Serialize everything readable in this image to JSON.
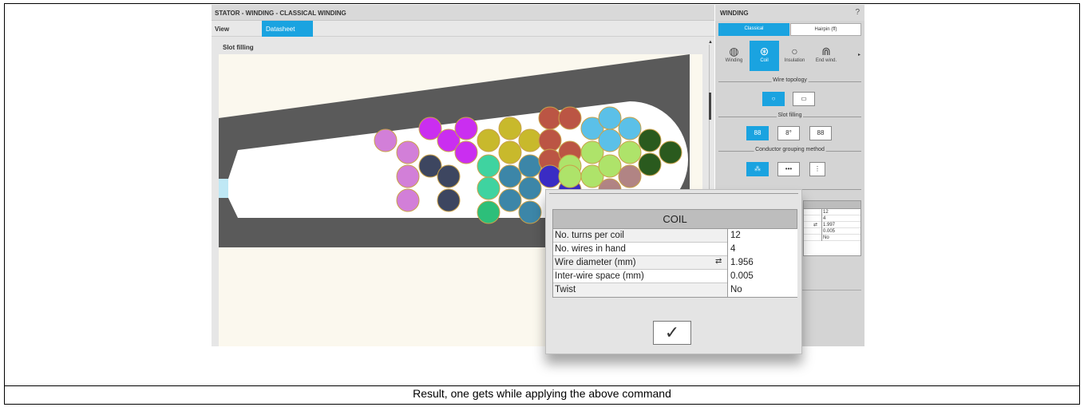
{
  "main": {
    "title": "STATOR - WINDING - CLASSICAL WINDING",
    "tabs": {
      "view": "View",
      "datasheet": "Datasheet"
    },
    "section_title": "Slot filling"
  },
  "side": {
    "title": "WINDING",
    "help": "?",
    "segments": {
      "classical": "Classical",
      "hairpin": "Hairpin (ff)"
    },
    "icon_buttons": [
      {
        "label": "Winding",
        "icon": "winding-icon",
        "glyph": "◍"
      },
      {
        "label": "Coil",
        "icon": "coil-icon",
        "glyph": "⊛"
      },
      {
        "label": "Insulation",
        "icon": "insulation-icon",
        "glyph": "○"
      },
      {
        "label": "End wind.",
        "icon": "end-winding-icon",
        "glyph": "⋒"
      }
    ],
    "more_arrow": "▸",
    "wire_topology": {
      "label": "Wire topology",
      "round": "○",
      "rect": "▭"
    },
    "slot_filling": {
      "label": "Slot filling",
      "opt1": "88",
      "opt2": "8°",
      "opt3": "88"
    },
    "grouping": {
      "label": "Conductor grouping method",
      "opt1": "⁂",
      "opt2": "•••",
      "opt3": "⋮"
    },
    "mini_table": {
      "values": [
        "12",
        "4",
        "1.997",
        "0.005",
        "No"
      ],
      "swap_symbol": "⇄"
    }
  },
  "dialog": {
    "title": "COIL",
    "rows": [
      {
        "label": "No. turns per coil",
        "value": "12"
      },
      {
        "label": "No. wires in hand",
        "value": "4"
      },
      {
        "label": "Wire diameter (mm)",
        "value": "1.956"
      },
      {
        "label": "Inter-wire space (mm)",
        "value": "0.005"
      },
      {
        "label": "Twist",
        "value": "No"
      }
    ],
    "swap_symbol": "⇄",
    "ok": "✓"
  },
  "caption": "Result, one gets while applying the above command",
  "colors": {
    "accent": "#1aa3e0",
    "stator": "#5a5a5a",
    "wire_palette": [
      "#d27fd8",
      "#ca2ef0",
      "#3d4660",
      "#c8b92c",
      "#bb5544",
      "#5bc0e8",
      "#2a5a1e",
      "#3fd3a0",
      "#3c86a8",
      "#aee36a",
      "#b18484",
      "#3a2cc4",
      "#2dbf7a"
    ]
  }
}
